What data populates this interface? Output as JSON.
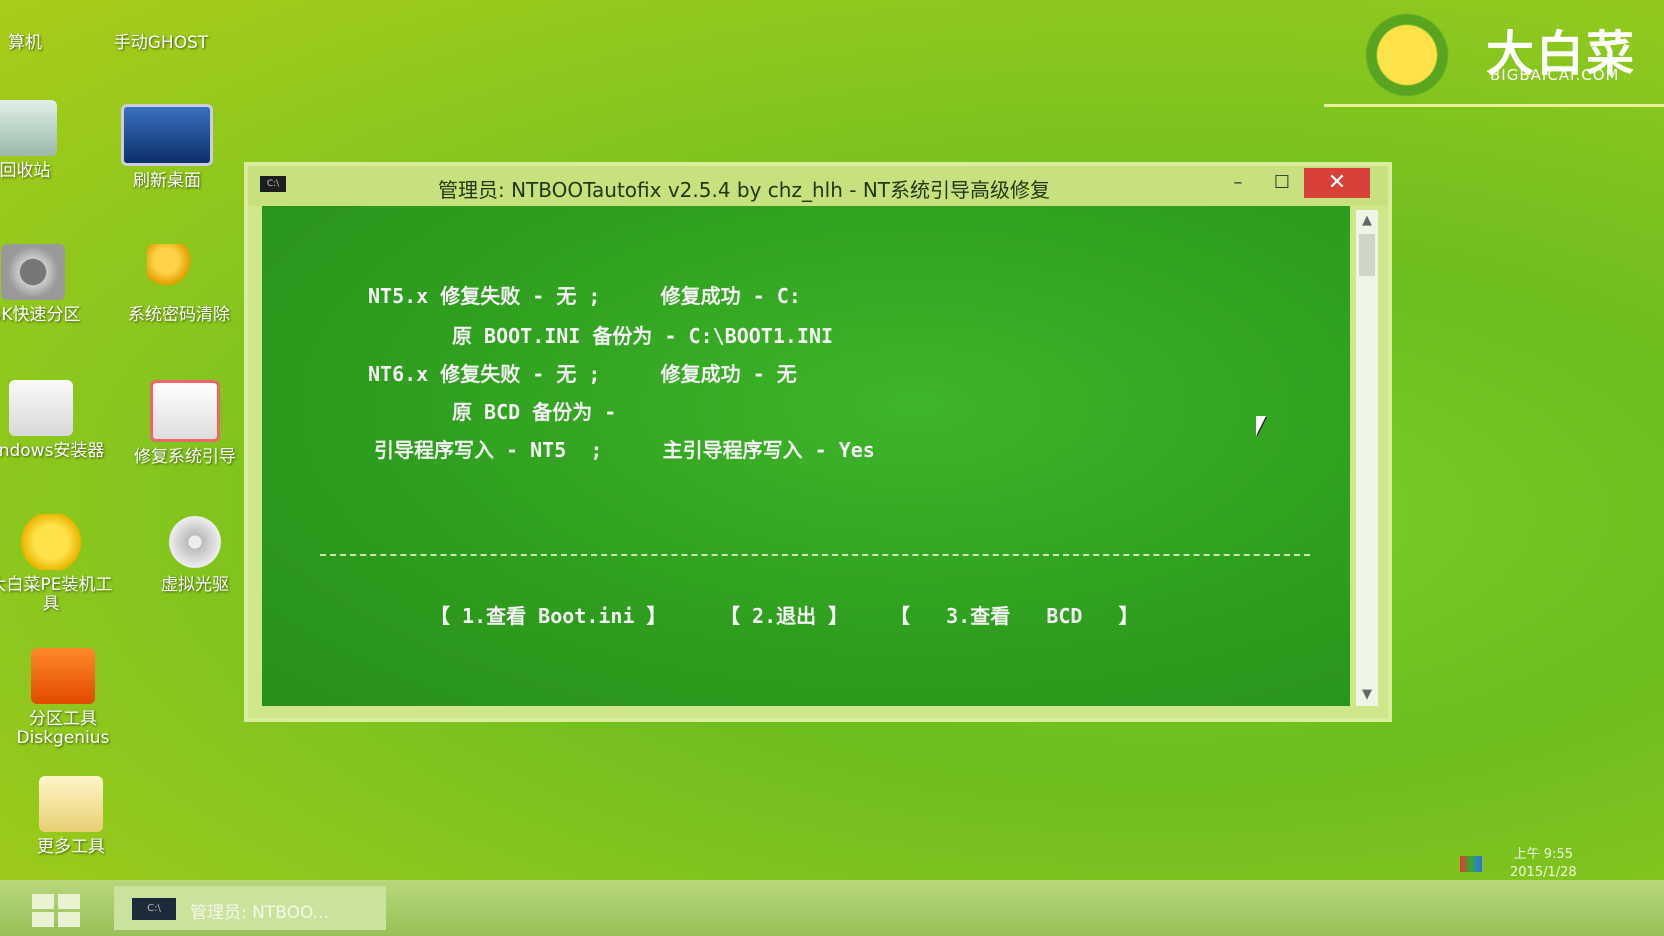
{
  "desktop": {
    "icons": [
      {
        "label": "算机",
        "icon": "computer-icon"
      },
      {
        "label": "手动GHOST",
        "icon": "ghost-icon"
      },
      {
        "label": "回收站",
        "icon": "recycle-bin-icon"
      },
      {
        "label": "刷新桌面",
        "icon": "monitor-icon"
      },
      {
        "label": "ISK快速分区",
        "icon": "gear-icon"
      },
      {
        "label": "系统密码清除",
        "icon": "key-icon"
      },
      {
        "label": "Windows安装器",
        "icon": "installer-icon"
      },
      {
        "label": "修复系统引导",
        "icon": "toolbox-icon"
      },
      {
        "label": "大白菜PE装机工具",
        "icon": "mascot-icon"
      },
      {
        "label": "虚拟光驱",
        "icon": "disc-icon"
      },
      {
        "label": "分区工具Diskgenius",
        "icon": "diskgenius-icon"
      },
      {
        "label": "更多工具",
        "icon": "folder-icon"
      }
    ]
  },
  "logo": {
    "brand": "大白菜",
    "site": "BIGBAICAI.COM"
  },
  "window": {
    "title": "管理员:  NTBOOTautofix v2.5.4 by chz_hlh - NT系统引导高级修复",
    "console_icon_text": "C:\\",
    "controls": {
      "minimize": "–",
      "maximize": "☐",
      "close": "✕"
    },
    "lines": [
      "NT5.x 修复失败 - 无 ;     修复成功 - C:",
      "原 BOOT.INI 备份为 - C:\\BOOT1.INI",
      "NT6.x 修复失败 - 无 ;     修复成功 - 无",
      "原 BCD 备份为 -",
      "引导程序写入 - NT5  ;     主引导程序写入 - Yes"
    ],
    "menu": [
      "【 1.查看 Boot.ini 】",
      "【 2.退出 】",
      "【   3.查看   BCD   】"
    ]
  },
  "taskbar": {
    "task_label": "管理员: NTBOO...",
    "clock_time": "上午 9:55",
    "clock_date": "2015/1/28"
  }
}
